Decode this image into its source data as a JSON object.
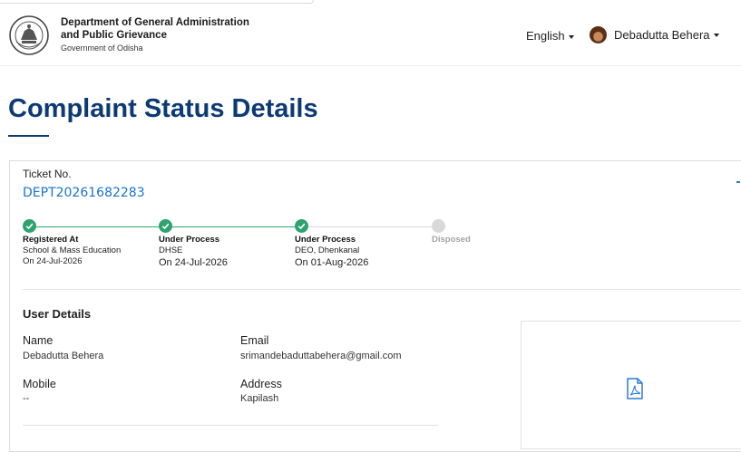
{
  "header": {
    "org_line1": "Department of General Administration",
    "org_line2": "and Public Grievance",
    "org_line3": "Government of Odisha",
    "language": "English",
    "user_name": "Debadutta Behera"
  },
  "page": {
    "title": "Complaint Status Details"
  },
  "ticket": {
    "label": "Ticket No.",
    "number": "DEPT20261682283"
  },
  "tracker": {
    "steps": [
      {
        "status": "Registered At",
        "dept": "School & Mass Education",
        "date": "On 24-Jul-2026",
        "state": "done"
      },
      {
        "status": "Under Process",
        "dept": "DHSE",
        "date": "On 24-Jul-2026",
        "state": "done"
      },
      {
        "status": "Under Process",
        "dept": "DEO, Dhenkanal",
        "date": "On 01-Aug-2026",
        "state": "done"
      },
      {
        "status": "Disposed",
        "dept": "",
        "date": "",
        "state": "pending"
      }
    ],
    "colors": {
      "done": "#2ea36f",
      "pending": "#d9d9d9",
      "line_done": "#2ea36f",
      "line_pending": "#d9d9d9"
    }
  },
  "user_details": {
    "title": "User Details",
    "name_label": "Name",
    "name_value": "Debadutta Behera",
    "email_label": "Email",
    "email_value": "srimandebaduttabehera@gmail.com",
    "mobile_label": "Mobile",
    "mobile_value": "--",
    "address_label": "Address",
    "address_value": "Kapilash"
  },
  "attachment": {
    "icon": "pdf-file-icon"
  },
  "colors": {
    "title": "#0d3a75",
    "link": "#1a73c9",
    "success": "#2ea36f"
  }
}
